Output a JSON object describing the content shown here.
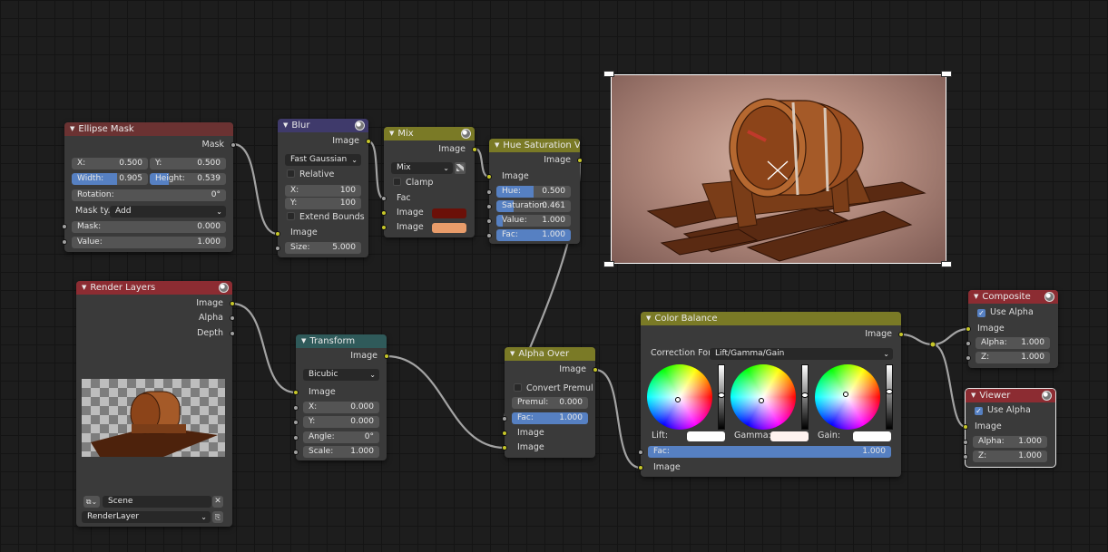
{
  "colors": {
    "header_mask": "#6b3232",
    "header_filter": "#3f3a6b",
    "header_color": "#7a7a26",
    "header_distort": "#2f5a5a",
    "header_input": "#8c2c32",
    "header_output": "#8c2c32",
    "socket_color": "#c7c729",
    "socket_float": "#a1a1a1",
    "field_accent": "#5680c2",
    "mix_color1": "#6b1008",
    "mix_color2": "#e89c6a"
  },
  "ellipse_mask": {
    "title": "Ellipse Mask",
    "out_mask": "Mask",
    "x_label": "X:",
    "x_value": "0.500",
    "y_label": "Y:",
    "y_value": "0.500",
    "width_label": "Width:",
    "width_value": "0.905",
    "height_label": "Height:",
    "height_value": "0.539",
    "rotation_label": "Rotation:",
    "rotation_value": "0°",
    "mask_type_label": "Mask ty...",
    "mask_type_value": "Add",
    "mask_label": "Mask:",
    "mask_value": "0.000",
    "value_label": "Value:",
    "value_value": "1.000"
  },
  "blur": {
    "title": "Blur",
    "out_image": "Image",
    "filter_type": "Fast Gaussian",
    "relative_label": "Relative",
    "x_label": "X:",
    "x_value": "100",
    "y_label": "Y:",
    "y_value": "100",
    "extend_label": "Extend Bounds",
    "in_image": "Image",
    "size_label": "Size:",
    "size_value": "5.000"
  },
  "mix": {
    "title": "Mix",
    "out_image": "Image",
    "blend_type": "Mix",
    "clamp_label": "Clamp",
    "in_fac": "Fac",
    "in_image1": "Image",
    "in_image2": "Image"
  },
  "hue_sat": {
    "title": "Hue Saturation Val...",
    "out_image": "Image",
    "in_image": "Image",
    "hue_label": "Hue:",
    "hue_value": "0.500",
    "sat_label": "Saturation:",
    "sat_value": "0.461",
    "val_label": "Value:",
    "val_value": "1.000",
    "fac_label": "Fac:",
    "fac_value": "1.000"
  },
  "render_layers": {
    "title": "Render Layers",
    "out_image": "Image",
    "out_alpha": "Alpha",
    "out_depth": "Depth",
    "scene_value": "Scene",
    "layer_value": "RenderLayer"
  },
  "transform": {
    "title": "Transform",
    "out_image": "Image",
    "filter_type": "Bicubic",
    "in_image": "Image",
    "x_label": "X:",
    "x_value": "0.000",
    "y_label": "Y:",
    "y_value": "0.000",
    "angle_label": "Angle:",
    "angle_value": "0°",
    "scale_label": "Scale:",
    "scale_value": "1.000"
  },
  "alpha_over": {
    "title": "Alpha Over",
    "out_image": "Image",
    "convert_label": "Convert Premul",
    "premul_label": "Premul:",
    "premul_value": "0.000",
    "fac_label": "Fac:",
    "fac_value": "1.000",
    "in_image1": "Image",
    "in_image2": "Image"
  },
  "color_balance": {
    "title": "Color Balance",
    "out_image": "Image",
    "correction_label": "Correction For...",
    "correction_value": "Lift/Gamma/Gain",
    "lift_label": "Lift:",
    "gamma_label": "Gamma:",
    "gain_label": "Gain:",
    "fac_label": "Fac:",
    "fac_value": "1.000",
    "in_image": "Image"
  },
  "composite": {
    "title": "Composite",
    "use_alpha_label": "Use Alpha",
    "in_image": "Image",
    "alpha_label": "Alpha:",
    "alpha_value": "1.000",
    "z_label": "Z:",
    "z_value": "1.000"
  },
  "viewer": {
    "title": "Viewer",
    "use_alpha_label": "Use Alpha",
    "in_image": "Image",
    "alpha_label": "Alpha:",
    "alpha_value": "1.000",
    "z_label": "Z:",
    "z_value": "1.000"
  },
  "icons": [
    "node-menu-icon",
    "render-icon",
    "scene-browse-icon",
    "close-icon",
    "new-layer-icon",
    "checkbox-icon",
    "chevron-down-icon",
    "crosshair-icon"
  ]
}
